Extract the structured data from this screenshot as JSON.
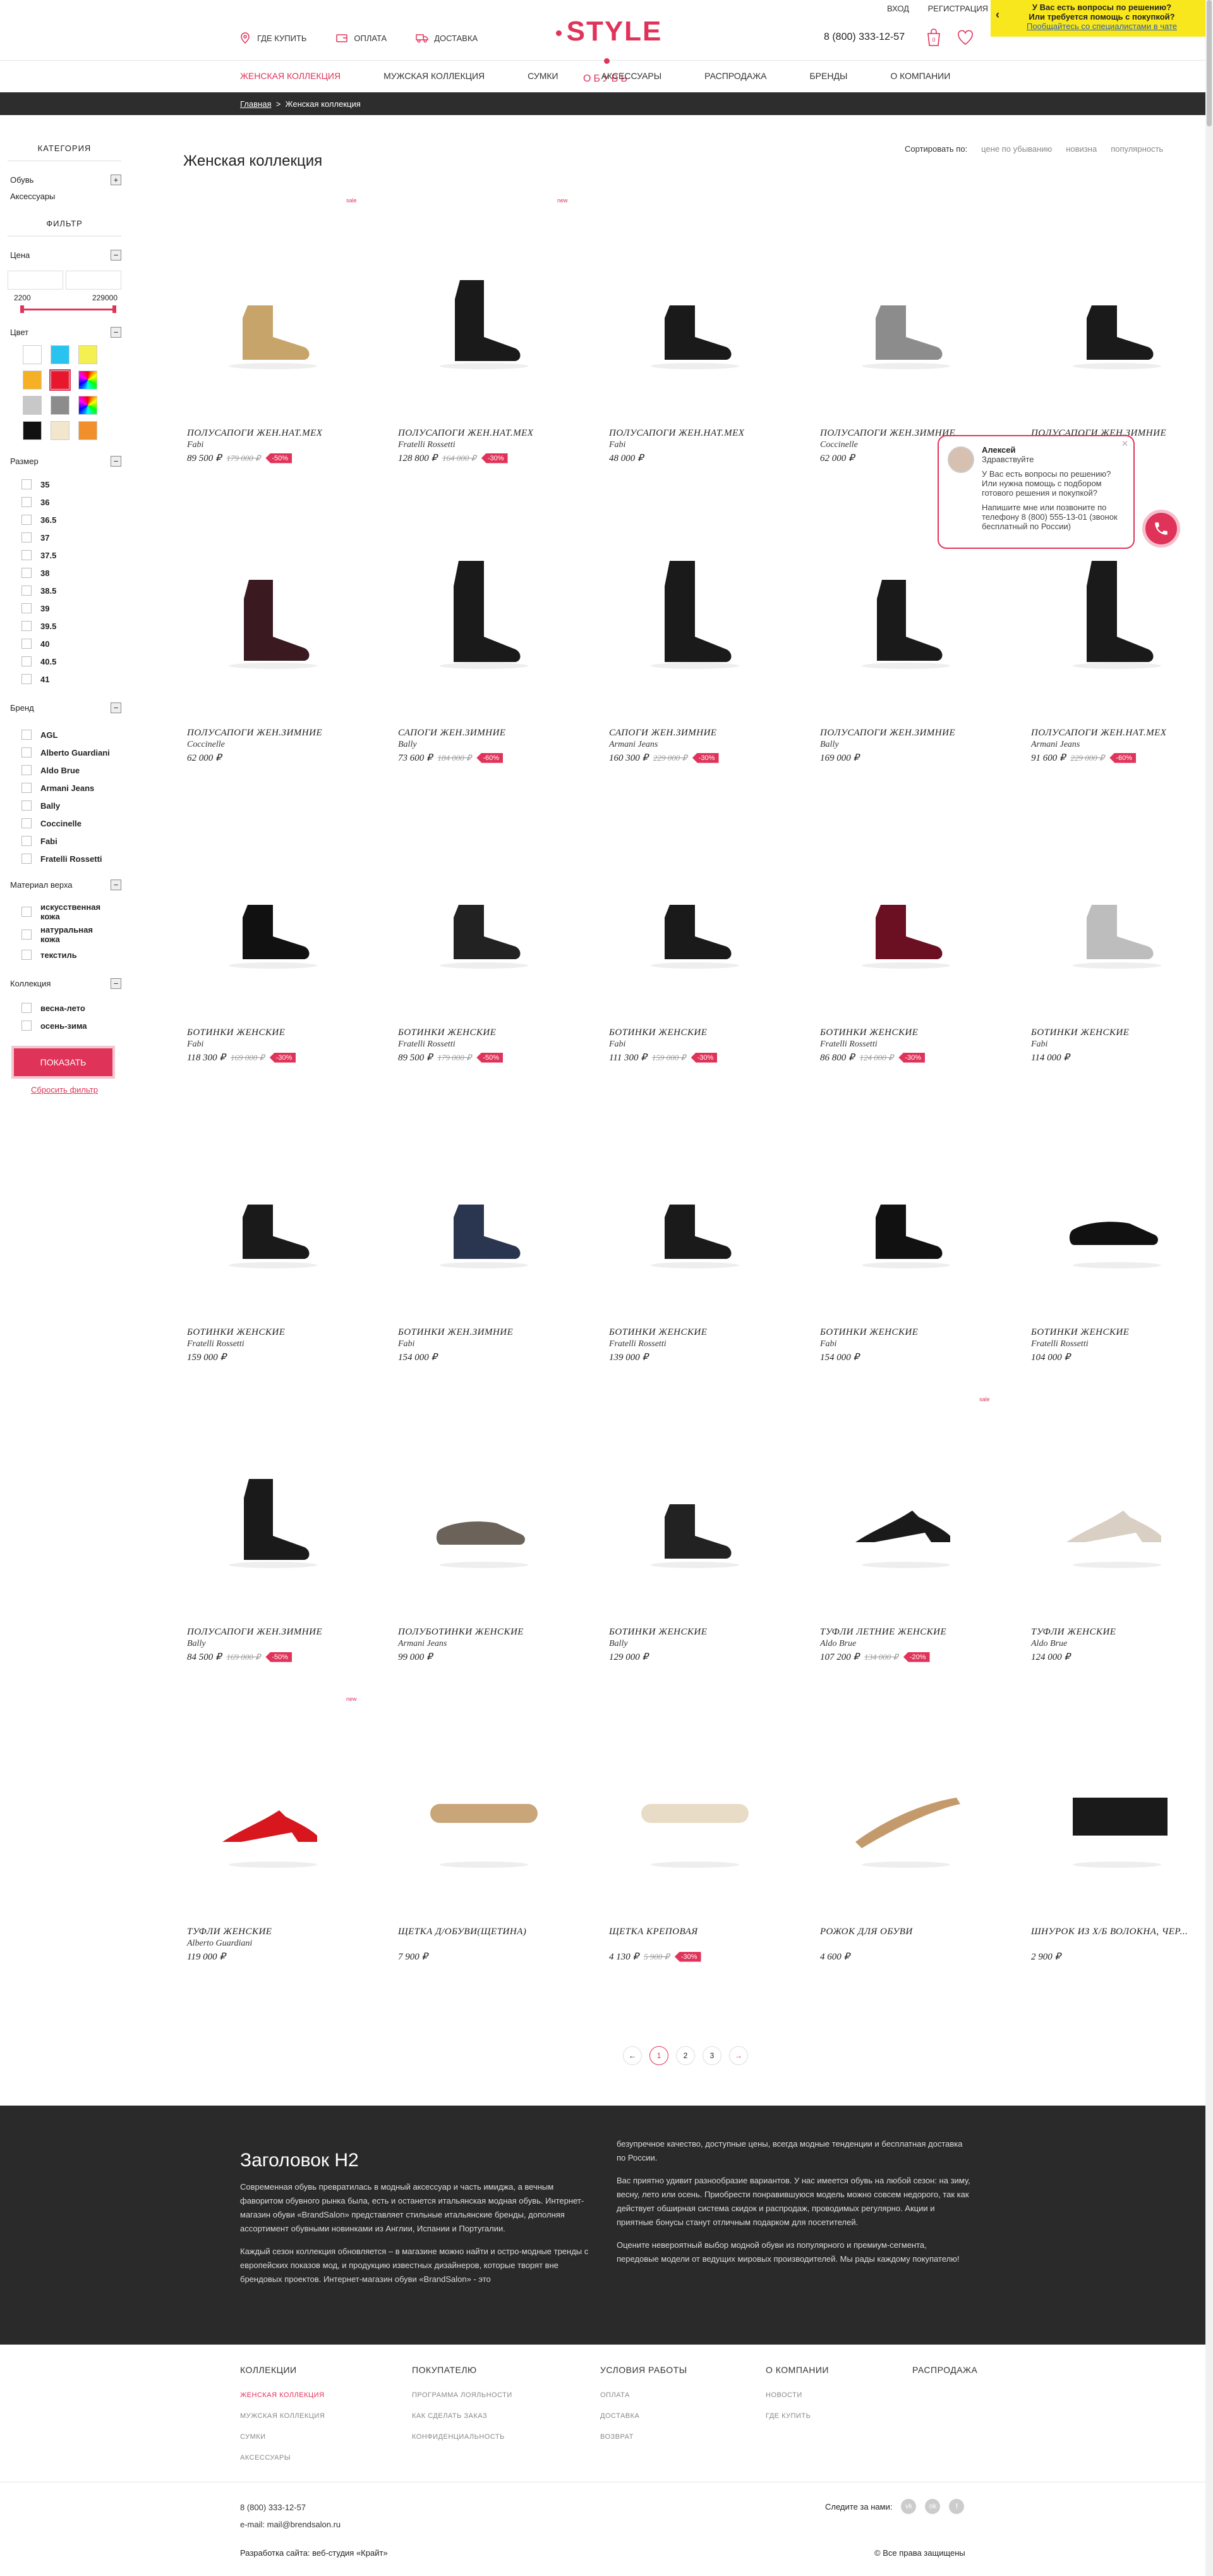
{
  "header": {
    "login": "ВХОД",
    "register": "РЕГИСТРАЦИЯ",
    "help_line1": "У Вас есть вопросы по решению?",
    "help_line2": "Или требуется помощь с покупкой?",
    "help_link": "Пообщайтесь со специалистами в чате",
    "where_to_buy": "ГДЕ КУПИТЬ",
    "payment": "ОПЛАТА",
    "delivery": "ДОСТАВКА",
    "logo_main": "STYLE",
    "logo_sub": "ОБУВЬ",
    "phone": "8 (800) 333-12-57",
    "cart_count": "0",
    "accent_color": "#e03359"
  },
  "nav": [
    "ЖЕНСКАЯ КОЛЛЕКЦИЯ",
    "МУЖСКАЯ КОЛЛЕКЦИЯ",
    "СУМКИ",
    "АКСЕССУАРЫ",
    "РАСПРОДАЖА",
    "БРЕНДЫ",
    "О КОМПАНИИ"
  ],
  "breadcrumb": {
    "home": "Главная",
    "sep": ">",
    "current": "Женская коллекция"
  },
  "sidebar": {
    "category_title": "КАТЕГОРИЯ",
    "categories": [
      "Обувь",
      "Аксессуары"
    ],
    "filter_title": "ФИЛЬТР",
    "price_label": "Цена",
    "price_min": "2200",
    "price_max": "229000",
    "color_label": "Цвет",
    "colors": [
      "#ffffff",
      "#29c3f0",
      "#f5f052",
      "#f5b025",
      "#e8182c",
      "rainbow",
      "#c8c8c8",
      "#8c8c8c",
      "rainbow",
      "#111111",
      "#f2e6cc",
      "#f08f2b"
    ],
    "size_label": "Размер",
    "sizes": [
      "35",
      "36",
      "36.5",
      "37",
      "37.5",
      "38",
      "38.5",
      "39",
      "39.5",
      "40",
      "40.5",
      "41"
    ],
    "brand_label": "Бренд",
    "brands": [
      "AGL",
      "Alberto Guardiani",
      "Aldo Brue",
      "Armani Jeans",
      "Bally",
      "Coccinelle",
      "Fabi",
      "Fratelli Rossetti"
    ],
    "material_label": "Материал верха",
    "materials": [
      "искусственная кожа",
      "натуральная кожа",
      "текстиль"
    ],
    "collection_label": "Коллекция",
    "collections": [
      "весна-лето",
      "осень-зима"
    ],
    "show_button": "ПОКАЗАТЬ",
    "reset": "Сбросить фильтр"
  },
  "main": {
    "title": "Женская коллекция",
    "sort_label": "Сортировать по:",
    "sort_options": [
      "цене по убыванию",
      "новизна",
      "популярность"
    ]
  },
  "products": [
    {
      "name": "ПОЛУСАПОГИ ЖЕН.НАТ.МЕХ",
      "brand": "Fabi",
      "price": "89 500 ₽",
      "old": "179 000 ₽",
      "disc": "-50%",
      "tag": "sale",
      "icon": "bootie-gold-icon"
    },
    {
      "name": "ПОЛУСАПОГИ ЖЕН.НАТ.МЕХ",
      "brand": "Fratelli Rossetti",
      "price": "128 800 ₽",
      "old": "164 000 ₽",
      "disc": "-30%",
      "tag": "new",
      "icon": "fur-boot-icon"
    },
    {
      "name": "ПОЛУСАПОГИ ЖЕН.НАТ.МЕХ",
      "brand": "Fabi",
      "price": "48 000 ₽",
      "old": "",
      "disc": "",
      "tag": "",
      "icon": "ankle-boot-icon"
    },
    {
      "name": "ПОЛУСАПОГИ ЖЕН.ЗИМНИЕ",
      "brand": "Coccinelle",
      "price": "62 000 ₽",
      "old": "",
      "disc": "",
      "tag": "",
      "icon": "grey-boot-icon"
    },
    {
      "name": "ПОЛУСАПОГИ ЖЕН.ЗИМНИЕ",
      "brand": "",
      "price": "",
      "old": "",
      "disc": "",
      "tag": "",
      "icon": "ankle-boot-icon"
    },
    {
      "name": "ПОЛУСАПОГИ ЖЕН.ЗИМНИЕ",
      "brand": "Coccinelle",
      "price": "62 000 ₽",
      "old": "",
      "disc": "",
      "tag": "",
      "icon": "burgundy-boot-icon"
    },
    {
      "name": "САПОГИ ЖЕН.ЗИМНИЕ",
      "brand": "Bally",
      "price": "73 600 ₽",
      "old": "184 000 ₽",
      "disc": "-60%",
      "tag": "",
      "icon": "tall-boot-icon"
    },
    {
      "name": "САПОГИ ЖЕН.ЗИМНИЕ",
      "brand": "Armani Jeans",
      "price": "160 300 ₽",
      "old": "229 000 ₽",
      "disc": "-30%",
      "tag": "",
      "icon": "tall-boot-icon"
    },
    {
      "name": "ПОЛУСАПОГИ ЖЕН.ЗИМНИЕ",
      "brand": "Bally",
      "price": "169 000 ₽",
      "old": "",
      "disc": "",
      "tag": "",
      "icon": "mid-boot-icon"
    },
    {
      "name": "ПОЛУСАПОГИ ЖЕН.НАТ.МЕХ",
      "brand": "Armani Jeans",
      "price": "91 600 ₽",
      "old": "229 000 ₽",
      "disc": "-60%",
      "tag": "",
      "icon": "tall-boot-icon"
    },
    {
      "name": "БОТИНКИ ЖЕНСКИЕ",
      "brand": "Fabi",
      "price": "118 300 ₽",
      "old": "169 000 ₽",
      "disc": "-30%",
      "tag": "",
      "icon": "chelsea-boot-icon"
    },
    {
      "name": "БОТИНКИ ЖЕНСКИЕ",
      "brand": "Fratelli Rossetti",
      "price": "89 500 ₽",
      "old": "179 000 ₽",
      "disc": "-50%",
      "tag": "",
      "icon": "laced-boot-icon"
    },
    {
      "name": "БОТИНКИ ЖЕНСКИЕ",
      "brand": "Fabi",
      "price": "111 300 ₽",
      "old": "159 000 ₽",
      "disc": "-30%",
      "tag": "",
      "icon": "ankle-boot-icon"
    },
    {
      "name": "БОТИНКИ ЖЕНСКИЕ",
      "brand": "Fratelli Rossetti",
      "price": "86 800 ₽",
      "old": "124 000 ₽",
      "disc": "-30%",
      "tag": "",
      "icon": "burgundy-chelsea-icon"
    },
    {
      "name": "БОТИНКИ ЖЕНСКИЕ",
      "brand": "Fabi",
      "price": "114 000 ₽",
      "old": "",
      "disc": "",
      "tag": "",
      "icon": "desert-boot-icon"
    },
    {
      "name": "БОТИНКИ ЖЕНСКИЕ",
      "brand": "Fratelli Rossetti",
      "price": "159 000 ₽",
      "old": "",
      "disc": "",
      "tag": "",
      "icon": "ankle-boot-icon"
    },
    {
      "name": "БОТИНКИ ЖЕН.ЗИМНИЕ",
      "brand": "Fabi",
      "price": "154 000 ₽",
      "old": "",
      "disc": "",
      "tag": "",
      "icon": "buckle-boot-icon"
    },
    {
      "name": "БОТИНКИ ЖЕНСКИЕ",
      "brand": "Fratelli Rossetti",
      "price": "139 000 ₽",
      "old": "",
      "disc": "",
      "tag": "",
      "icon": "ankle-boot-icon"
    },
    {
      "name": "БОТИНКИ ЖЕНСКИЕ",
      "brand": "Fabi",
      "price": "154 000 ₽",
      "old": "",
      "disc": "",
      "tag": "",
      "icon": "heel-boot-icon"
    },
    {
      "name": "БОТИНКИ ЖЕНСКИЕ",
      "brand": "Fratelli Rossetti",
      "price": "104 000 ₽",
      "old": "",
      "disc": "",
      "tag": "",
      "icon": "pointed-boot-icon"
    },
    {
      "name": "ПОЛУСАПОГИ ЖЕН.ЗИМНИЕ",
      "brand": "Bally",
      "price": "84 500 ₽",
      "old": "169 000 ₽",
      "disc": "-50%",
      "tag": "",
      "icon": "mid-boot-icon"
    },
    {
      "name": "ПОЛУБОТИНКИ ЖЕНСКИЕ",
      "brand": "Armani Jeans",
      "price": "99 000 ₽",
      "old": "",
      "disc": "",
      "tag": "",
      "icon": "sneaker-icon"
    },
    {
      "name": "БОТИНКИ ЖЕНСКИЕ",
      "brand": "Bally",
      "price": "129 000 ₽",
      "old": "",
      "disc": "",
      "tag": "",
      "icon": "quilted-boot-icon"
    },
    {
      "name": "ТУФЛИ ЛЕТНИЕ ЖЕНСКИЕ",
      "brand": "Aldo Brue",
      "price": "107 200 ₽",
      "old": "134 000 ₽",
      "disc": "-20%",
      "tag": "sale",
      "icon": "heel-sandal-icon"
    },
    {
      "name": "ТУФЛИ ЖЕНСКИЕ",
      "brand": "Aldo Brue",
      "price": "124 000 ₽",
      "old": "",
      "disc": "",
      "tag": "",
      "icon": "pump-print-icon"
    },
    {
      "name": "ТУФЛИ ЖЕНСКИЕ",
      "brand": "Alberto Guardiani",
      "price": "119 000 ₽",
      "old": "",
      "disc": "",
      "tag": "new",
      "icon": "red-pump-icon"
    },
    {
      "name": "ЩЕТКА Д/ОБУВИ(ЩЕТИНА)",
      "brand": "",
      "price": "7 900 ₽",
      "old": "",
      "disc": "",
      "tag": "",
      "icon": "brush-icon"
    },
    {
      "name": "ЩЕТКА КРЕПОВАЯ",
      "brand": "",
      "price": "4 130 ₽",
      "old": "5 900 ₽",
      "disc": "-30%",
      "tag": "",
      "icon": "crepe-brush-icon"
    },
    {
      "name": "РОЖОК ДЛЯ ОБУВИ",
      "brand": "",
      "price": "4 600 ₽",
      "old": "",
      "disc": "",
      "tag": "",
      "icon": "shoehorn-icon"
    },
    {
      "name": "ШНУРОК ИЗ Х/Б ВОЛОКНА, ЧЕР...",
      "brand": "",
      "price": "2 900 ₽",
      "old": "",
      "disc": "",
      "tag": "",
      "icon": "laces-icon"
    }
  ],
  "pagination": {
    "prev": "←",
    "pages": [
      "1",
      "2",
      "3"
    ],
    "next": "→",
    "current": "1"
  },
  "chat": {
    "name": "Алексей",
    "greet": "Здравствуйте",
    "msg1": "У Вас есть вопросы по решению? Или нужна помощь с подбором готового решения и покупкой?",
    "msg2": "Напишите мне или позвоните по телефону 8 (800) 555-13-01 (звонок бесплатный по России)",
    "close": "✕"
  },
  "seo": {
    "title": "Заголовок H2",
    "p1": "Современная обувь превратилась в модный аксессуар и часть имиджа, а вечным фаворитом обувного рынка была, есть и останется итальянская модная обувь. Интернет-магазин обуви «BrandSalon» представляет стильные итальянские бренды, дополняя ассортимент обувными новинками из Англии, Испании и Португалии.",
    "p2": "Каждый сезон коллекция обновляется – в магазине можно найти и остро-модные тренды с европейских показов мод, и продукцию известных дизайнеров, которые творят вне брендовых проектов. Интернет-магазин обуви «BrandSalon» - это",
    "p3": "безупречное качество, доступные цены, всегда модные тенденции и бесплатная доставка по России.",
    "p4": "Вас приятно удивит разнообразие вариантов. У нас имеется обувь на любой сезон: на зиму, весну, лето или осень. Приобрести понравившуюся модель можно совсем недорого, так как действует обширная система скидок и распродаж, проводимых регулярно. Акции и приятные бонусы станут отличным подарком для посетителей.",
    "p5": "Оцените невероятный выбор модной обуви из популярного и премиум-сегмента, передовые модели от ведущих мировых производителей. Мы рады каждому покупателю!"
  },
  "footer": {
    "cols": [
      {
        "h": "КОЛЛЕКЦИИ",
        "links": [
          "ЖЕНСКАЯ КОЛЛЕКЦИЯ",
          "МУЖСКАЯ КОЛЛЕКЦИЯ",
          "СУМКИ",
          "АКСЕССУАРЫ"
        ]
      },
      {
        "h": "ПОКУПАТЕЛЮ",
        "links": [
          "ПРОГРАММА ЛОЯЛЬНОСТИ",
          "КАК СДЕЛАТЬ ЗАКАЗ",
          "КОНФИДЕНЦИАЛЬНОСТЬ"
        ]
      },
      {
        "h": "УСЛОВИЯ РАБОТЫ",
        "links": [
          "ОПЛАТА",
          "ДОСТАВКА",
          "ВОЗВРАТ"
        ]
      },
      {
        "h": "О КОМПАНИИ",
        "links": [
          "НОВОСТИ",
          "ГДЕ КУПИТЬ"
        ]
      },
      {
        "h": "РАСПРОДАЖА",
        "links": []
      }
    ],
    "phone": "8 (800) 333-12-57",
    "email": "e-mail: mail@brendsalon.ru",
    "follow": "Следите за нами:",
    "socials": [
      "vk",
      "ok",
      "f"
    ],
    "dev": "Разработка сайта: веб-студия «Крайт»",
    "copyright": "© Все права защищены"
  }
}
